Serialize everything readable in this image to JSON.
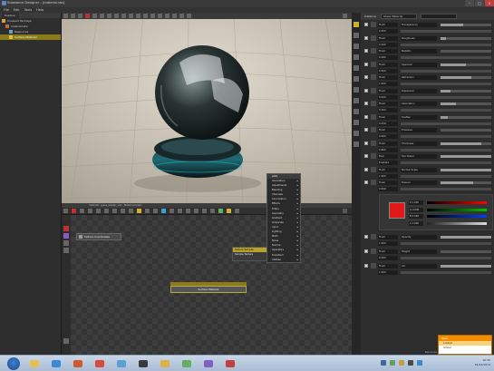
{
  "window": {
    "title": "Substance Designer – [material.sbs]",
    "minimize_glyph": "–",
    "maximize_glyph": "□",
    "close_glyph": "×"
  },
  "menu": [
    "File",
    "Edit",
    "Tools",
    "Help"
  ],
  "outliner": {
    "tab_label": "Explorer",
    "items": [
      {
        "label": "Unsaved Package",
        "selected": false,
        "indent": 0
      },
      {
        "label": "material.sbs",
        "selected": false,
        "indent": 1
      },
      {
        "label": "Resources",
        "selected": false,
        "indent": 2
      },
      {
        "label": "Surface Material",
        "selected": true,
        "indent": 2
      }
    ]
  },
  "viewport": {
    "toolbar_icons": 18
  },
  "shelf": {
    "label": "material  -  glass_shader_v01  -  Material Graph"
  },
  "node_editor": {
    "tab_label": "Material Graph",
    "tex_coord_label": "Texture Coordinates",
    "small_node": {
      "header": "Texture Sampler",
      "body": "Sample Texture"
    },
    "surface_node_label": "Surface Material"
  },
  "context_menu": {
    "header": "Add",
    "items": [
      "Generators",
      "Adjustments",
      "Blending",
      "Channels",
      "Convolution",
      "Effects",
      "Filters",
      "Geometry",
      "Gradient",
      "Grayscale",
      "Input",
      "Lighting",
      "Math",
      "Noise",
      "Normal",
      "Operators",
      "Transform",
      "Utilities"
    ]
  },
  "inspector": {
    "header_label": "Instance",
    "header_value": "Glass Material",
    "params": [
      {
        "type": "Float",
        "name": "Transparency",
        "value": "0.450",
        "slider": 0.45,
        "swatch": "#4a4a4a"
      },
      {
        "type": "Float",
        "name": "Roughness",
        "value": "0.100",
        "slider": 0.1,
        "swatch": "#4a4a4a"
      },
      {
        "type": "Float",
        "name": "Metallic",
        "value": "0.000",
        "slider": 0.0,
        "swatch": "#4a4a4a"
      },
      {
        "type": "Float",
        "name": "Specular",
        "value": "0.500",
        "slider": 0.5,
        "swatch": "#4a4a4a"
      },
      {
        "type": "Float",
        "name": "Refraction",
        "value": "1.520",
        "slider": 0.6,
        "swatch": "#4a4a4a"
      },
      {
        "type": "Float",
        "name": "Dispersion",
        "value": "0.020",
        "slider": 0.2,
        "swatch": "#4a4a4a"
      },
      {
        "type": "Float",
        "name": "Absorption",
        "value": "0.300",
        "slider": 0.3,
        "swatch": "#4a4a4a"
      },
      {
        "type": "Float",
        "name": "Scatter",
        "value": "0.150",
        "slider": 0.15,
        "swatch": "#4a4a4a"
      },
      {
        "type": "Float",
        "name": "Emissive",
        "value": "0.000",
        "slider": 0.0,
        "swatch": "#4a4a4a"
      },
      {
        "type": "Float",
        "name": "Thickness",
        "value": "0.800",
        "slider": 0.8,
        "swatch": "#4a4a4a"
      },
      {
        "type": "Bool",
        "name": "Two Sided",
        "value": "Enabled",
        "slider": 1.0,
        "swatch": "#4a4a4a"
      },
      {
        "type": "Float",
        "name": "Normal Scale",
        "value": "1.000",
        "slider": 1.0,
        "swatch": "#4a4a4a"
      },
      {
        "type": "Float",
        "name": "Fresnel",
        "value": "0.650",
        "slider": 0.65,
        "swatch": "#4a4a4a"
      }
    ],
    "color_section": {
      "type": "Color",
      "name": "BaseColor",
      "swatch": "#e01818",
      "channels": [
        {
          "label": "R 1.000",
          "from": "#000000",
          "to": "#ff0000"
        },
        {
          "label": "G 0.090",
          "from": "#000000",
          "to": "#00c000"
        },
        {
          "label": "B 0.090",
          "from": "#000000",
          "to": "#0040ff"
        },
        {
          "label": "A 1.000",
          "from": "#222222",
          "to": "#dddddd"
        }
      ]
    },
    "lower_params": [
      {
        "type": "Float",
        "name": "Opacity",
        "value": "1.000",
        "slider": 1.0,
        "swatch": "#4a4a4a"
      },
      {
        "type": "Float",
        "name": "Height",
        "value": "0.000",
        "slider": 0.0,
        "swatch": "#4a4a4a"
      },
      {
        "type": "Float",
        "name": "AO",
        "value": "1.000",
        "slider": 1.0,
        "swatch": "#4a4a4a"
      }
    ],
    "bottom_label": "Resources"
  },
  "popup": {
    "header": "Type",
    "items": [
      {
        "label": "Custom",
        "active": true
      },
      {
        "label": "Global",
        "active": false
      }
    ]
  },
  "taskbar": {
    "apps": [
      {
        "name": "explorer-icon",
        "color": "#e8c050"
      },
      {
        "name": "ie-icon",
        "color": "#3a8ad8"
      },
      {
        "name": "media-icon",
        "color": "#d05a30"
      },
      {
        "name": "chrome-icon",
        "color": "#d84a3a"
      },
      {
        "name": "paint-icon",
        "color": "#5aa0d8"
      },
      {
        "name": "sd-icon",
        "color": "#3a3a3a"
      },
      {
        "name": "folder-icon",
        "color": "#e0b040"
      },
      {
        "name": "app-icon",
        "color": "#60b060"
      },
      {
        "name": "app2-icon",
        "color": "#8060c0"
      },
      {
        "name": "app3-icon",
        "color": "#c04040"
      }
    ],
    "time": "10:35",
    "date": "01/24/2013"
  }
}
